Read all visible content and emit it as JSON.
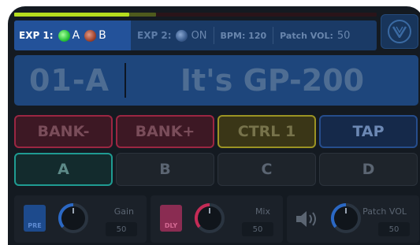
{
  "topbar": {
    "exp1_label": "EXP 1:",
    "exp1_opt_a": "A",
    "exp1_opt_b": "B",
    "exp2_label": "EXP 2:",
    "exp2_value": "ON",
    "bpm_label": "BPM: 120",
    "patch_vol_label": "Patch VOL:",
    "patch_vol_value": "50"
  },
  "patch": {
    "number": "01-A",
    "name": "It's GP-200"
  },
  "buttons": {
    "bank_minus": "BANK-",
    "bank_plus": "BANK+",
    "ctrl1": "CTRL 1",
    "tap": "TAP"
  },
  "footswitches": [
    "A",
    "B",
    "C",
    "D"
  ],
  "modules": {
    "pre": {
      "pedal_label": "PRE",
      "param_label": "Gain",
      "param_value": "50"
    },
    "dly": {
      "pedal_label": "DLY",
      "param_label": "Mix",
      "param_value": "50"
    },
    "vol": {
      "param_label": "Patch VOL",
      "param_value": "50"
    }
  },
  "colors": {
    "accent_green": "#b5dc1e",
    "patch_bg": "#1e467c",
    "bank_border": "#9b2642",
    "ctrl_border": "#9b9323",
    "tap_border": "#264d8c",
    "active_ft_border": "#1f9b92"
  },
  "icons": {
    "logo": "valeton-logo-icon",
    "speaker": "speaker-icon"
  }
}
